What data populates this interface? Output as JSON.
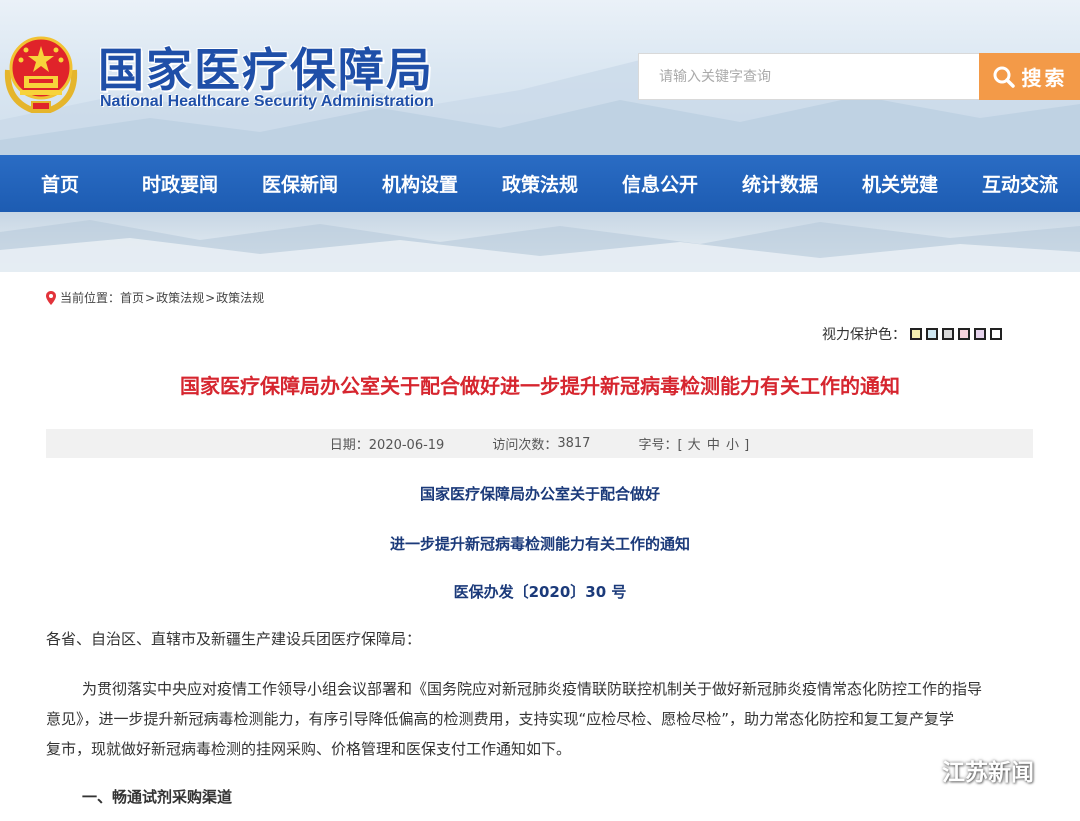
{
  "header": {
    "site_title": "国家医疗保障局",
    "site_subtitle": "National Healthcare Security Administration"
  },
  "search": {
    "placeholder": "请输入关键字查询",
    "button_label": "搜索"
  },
  "nav": {
    "items": [
      {
        "label": "首页"
      },
      {
        "label": "时政要闻"
      },
      {
        "label": "医保新闻"
      },
      {
        "label": "机构设置"
      },
      {
        "label": "政策法规"
      },
      {
        "label": "信息公开"
      },
      {
        "label": "统计数据"
      },
      {
        "label": "机关党建"
      },
      {
        "label": "互动交流"
      }
    ]
  },
  "breadcrumb": {
    "prefix": "当前位置：",
    "items": [
      "首页",
      "政策法规",
      "政策法规"
    ],
    "separator": ">"
  },
  "vision": {
    "label": "视力保护色：",
    "swatches": [
      "#f4f0b0",
      "#cfe7f1",
      "#d9d9d9",
      "#f7d2dc",
      "#e6d3ec",
      "#ffffff"
    ]
  },
  "article": {
    "title": "国家医疗保障局办公室关于配合做好进一步提升新冠病毒检测能力有关工作的通知",
    "meta": {
      "date": "日期：2020-06-19",
      "visits_label": "访问次数：",
      "visits": "3817",
      "fontsize_label": "字号：[",
      "size_large": "大",
      "size_medium": "中",
      "size_small": "小",
      "fontsize_close": "]"
    },
    "heading_line1": "国家医疗保障局办公室关于配合做好",
    "heading_line2": "进一步提升新冠病毒检测能力有关工作的通知",
    "doc_number": "医保办发〔2020〕30 号",
    "addressee": "各省、自治区、直辖市及新疆生产建设兵团医疗保障局：",
    "body_line1": "为贯彻落实中央应对疫情工作领导小组会议部署和《国务院应对新冠肺炎疫情联防联控机制关于做好新冠肺炎疫情常态化防控工作的指导",
    "body_line2": "意见》，进一步提升新冠病毒检测能力，有序引导降低偏高的检测费用，支持实现“应检尽检、愿检尽检”，助力常态化防控和复工复产复学",
    "body_line3": "复市，现就做好新冠病毒检测的挂网采购、价格管理和医保支付工作通知如下。",
    "section1": "一、畅通试剂采购渠道"
  },
  "watermark": {
    "text": "江苏新闻"
  },
  "colors": {
    "nav_blue": "#1d5cb2",
    "title_red": "#d6262f",
    "search_orange": "#f39a48",
    "brand_blue": "#1f4fa8"
  }
}
